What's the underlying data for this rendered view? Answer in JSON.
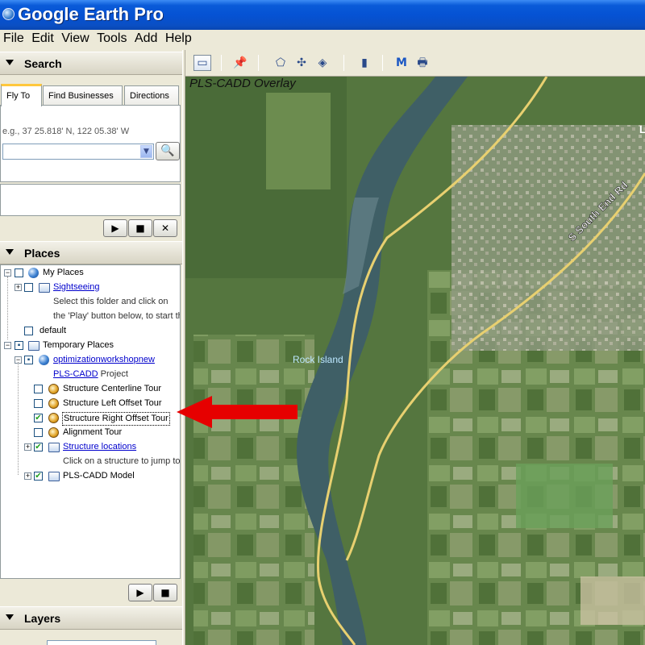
{
  "window": {
    "title": "Google Earth Pro"
  },
  "menu": [
    "File",
    "Edit",
    "View",
    "Tools",
    "Add",
    "Help"
  ],
  "search": {
    "header": "Search",
    "tabs": [
      "Fly To",
      "Find Businesses",
      "Directions"
    ],
    "hint": "e.g., 37 25.818' N, 122 05.38' W",
    "input_value": ""
  },
  "places": {
    "header": "Places",
    "items": [
      {
        "label": "My Places"
      },
      {
        "label": "Sightseeing"
      },
      {
        "label": "Select this folder and click on"
      },
      {
        "label": "the 'Play' button below, to start th"
      },
      {
        "label": "default"
      },
      {
        "label": "Temporary Places"
      },
      {
        "label": "optimizationworkshopnew"
      },
      {
        "label": "PLS-CADD"
      },
      {
        "label": " Project"
      },
      {
        "label": "Structure Centerline Tour"
      },
      {
        "label": "Structure Left Offset Tour"
      },
      {
        "label": "Structure Right Offset Tour"
      },
      {
        "label": "Alignment Tour"
      },
      {
        "label": "Structure locations"
      },
      {
        "label": "Click on a structure to jump to"
      },
      {
        "label": "PLS-CADD Model"
      }
    ]
  },
  "layers": {
    "header": "Layers"
  },
  "map": {
    "overlay_title": "PLS-CADD Overlay",
    "labels": {
      "island": "Rock Island",
      "road": "S South End Rd",
      "road2": "L"
    }
  },
  "colors": {
    "accent_arrow": "#e60000",
    "road": "#e8d070",
    "label_blue": "#bde8ff"
  },
  "icons": [
    "sidebar-icon",
    "placemark-icon",
    "polygon-icon",
    "path-icon",
    "overlay-icon",
    "ruler-icon",
    "email-icon",
    "print-icon",
    "search-icon",
    "play-icon",
    "stop-icon",
    "close-icon"
  ]
}
